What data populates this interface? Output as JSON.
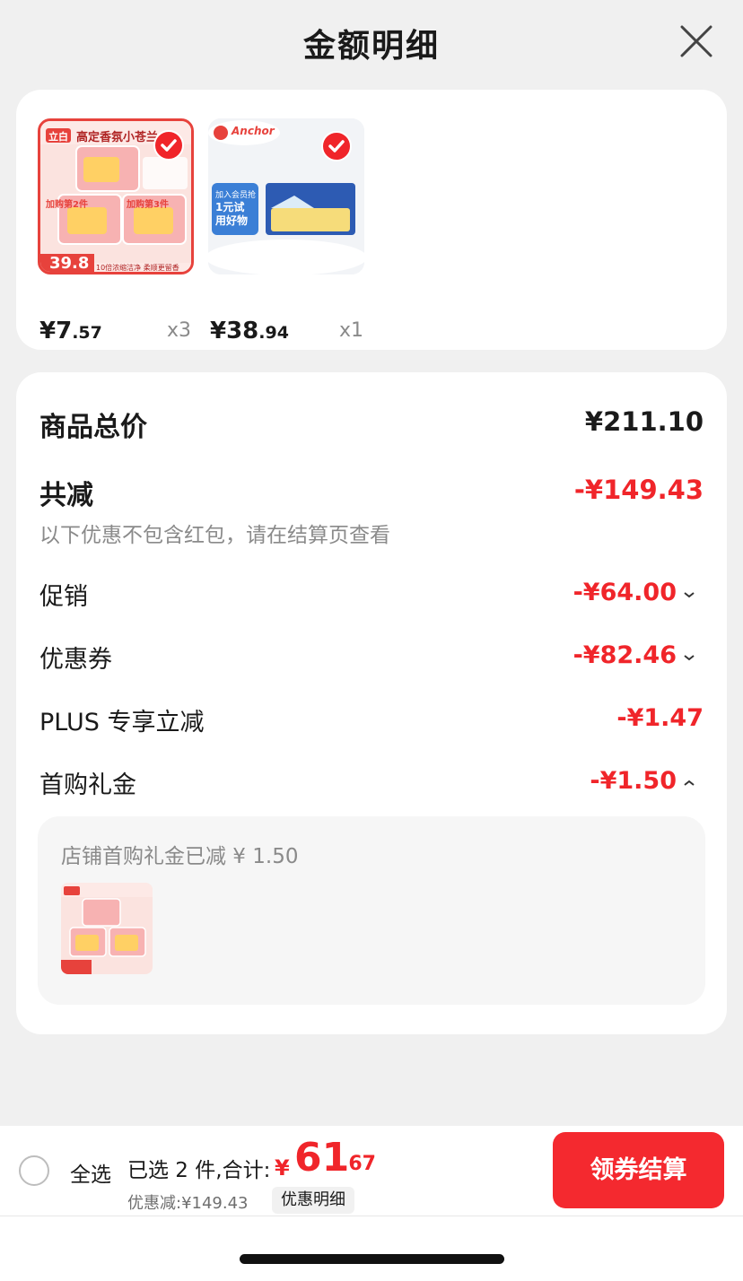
{
  "header": {
    "title": "金额明细"
  },
  "products": [
    {
      "image_text": {
        "brand": "立白",
        "headline": "高定香氛小苍兰",
        "badge_price": "39.8",
        "tagline": "10倍浓缩洁净 柔顺更留香",
        "promo1": "加购第2件",
        "promo2": "加购第3件"
      },
      "price_int": "¥7",
      "price_dec": ".57",
      "qty": "x3",
      "checked": true
    },
    {
      "image_text": {
        "brand": "Anchor",
        "promo": "加入会员抢",
        "promo_main": "1元试用好物"
      },
      "price_int": "¥38",
      "price_dec": ".94",
      "qty": "x1",
      "checked": true
    }
  ],
  "summary": {
    "total_label": "商品总价",
    "total_value": "¥211.10",
    "reduce_label": "共减",
    "reduce_value": "-¥149.43",
    "note": "以下优惠不包含红包，请在结算页查看",
    "rows": [
      {
        "label": "促销",
        "value": "-¥64.00",
        "expand": "down"
      },
      {
        "label": "优惠券",
        "value": "-¥82.46",
        "expand": "down"
      },
      {
        "label": "PLUS 专享立减",
        "value": "-¥1.47",
        "expand": "none"
      },
      {
        "label": "首购礼金",
        "value": "-¥1.50",
        "expand": "up"
      }
    ],
    "gift_detail": "店铺首购礼金已减 ¥ 1.50"
  },
  "bottom": {
    "select_all": "全选",
    "selected_info": "已选 2 件,合计:",
    "total_yen": "¥",
    "total_int": "61",
    "total_dec": ".67",
    "discount": "优惠减:¥149.43",
    "detail_link": "优惠明细",
    "checkout": "领券结算"
  },
  "colors": {
    "accent": "#f0252a",
    "checkout": "#f4292f",
    "muted": "#8a8a8a"
  }
}
